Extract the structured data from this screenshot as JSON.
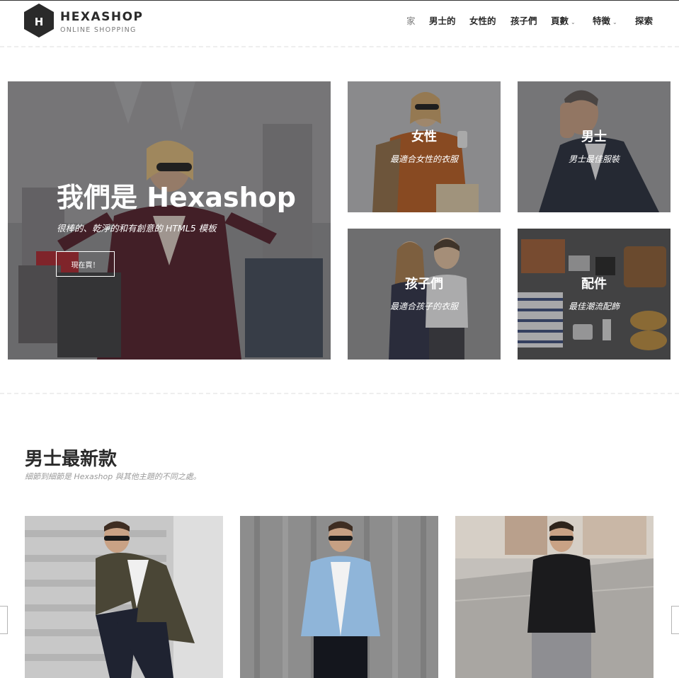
{
  "brand": {
    "logo_letter": "H",
    "name": "HEXASHOP",
    "tagline": "ONLINE SHOPPING"
  },
  "nav": {
    "items": [
      {
        "label": "家",
        "active": true
      },
      {
        "label": "男士的"
      },
      {
        "label": "女性的"
      },
      {
        "label": "孩子們"
      },
      {
        "label": "頁數",
        "dropdown": true
      },
      {
        "label": "特徵",
        "dropdown": true
      },
      {
        "label": "探索"
      }
    ]
  },
  "hero": {
    "title": "我們是 Hexashop",
    "subtitle": "很棒的、乾淨的和有創意的 HTML5 模板",
    "button_label": "現在買！"
  },
  "categories": [
    {
      "title": "女性",
      "subtitle": "最適合女性的衣服"
    },
    {
      "title": "男士",
      "subtitle": "男士最佳服裝"
    },
    {
      "title": "孩子們",
      "subtitle": "最適合孩子的衣服"
    },
    {
      "title": "配件",
      "subtitle": "最佳潮流配飾"
    }
  ],
  "latest": {
    "title": "男士最新款",
    "subtitle": "細節到細節是 Hexashop 與其他主題的不同之處。"
  },
  "colors": {
    "text_dark": "#2a2a2a",
    "text_muted": "#7a7a7a",
    "overlay": "rgba(40,40,40,0.32)"
  }
}
